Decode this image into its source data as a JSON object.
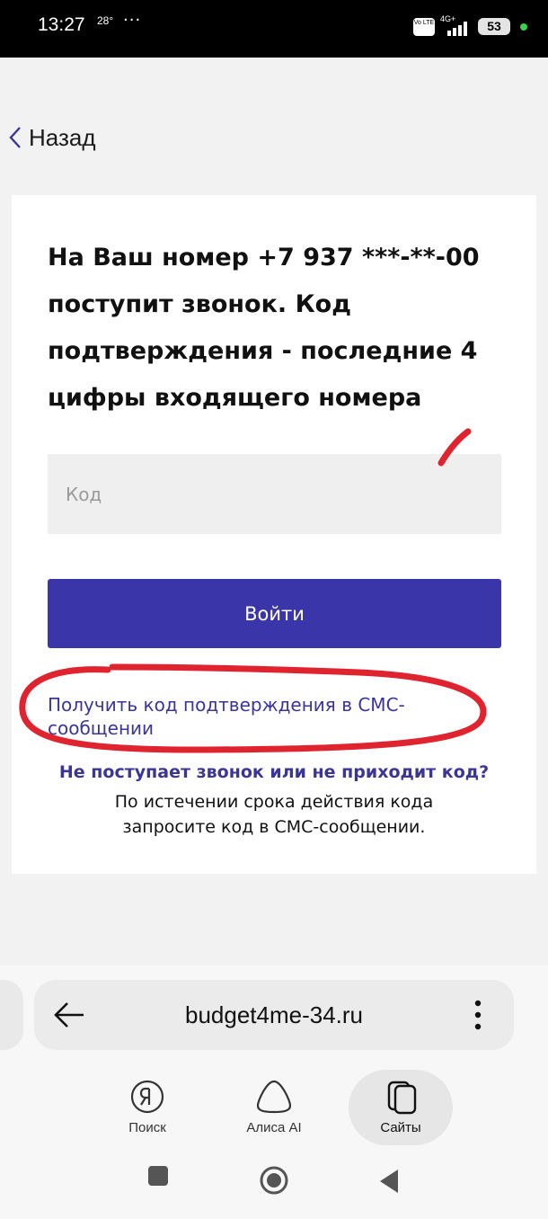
{
  "status_bar": {
    "time": "13:27",
    "temperature": "28°",
    "more": "···",
    "volte": "Vo LTE",
    "network": "4G+",
    "battery": "53"
  },
  "back_link": {
    "label": "Назад"
  },
  "card": {
    "title": "На Ваш номер +7 937 ***-**-00 поступит звонок. Код подтверждения - последние 4 цифры входящего номера",
    "code_placeholder": "Код",
    "login_button": "Войти",
    "sms_link": "Получить код подтверждения в СМС-сообщении",
    "help_link": "Не поступает звонок или не приходит код?",
    "help_text": "По истечении срока действия кода запросите код в СМС-сообщении."
  },
  "browser": {
    "url": "budget4me-34.ru",
    "nav": [
      {
        "label": "Поиск",
        "icon": "yandex-search-icon"
      },
      {
        "label": "Алиса AI",
        "icon": "alice-icon"
      },
      {
        "label": "Сайты",
        "icon": "tabs-icon"
      }
    ]
  },
  "colors": {
    "accent": "#3b35aa",
    "link": "#3a3598",
    "annotation": "#e0242f"
  }
}
